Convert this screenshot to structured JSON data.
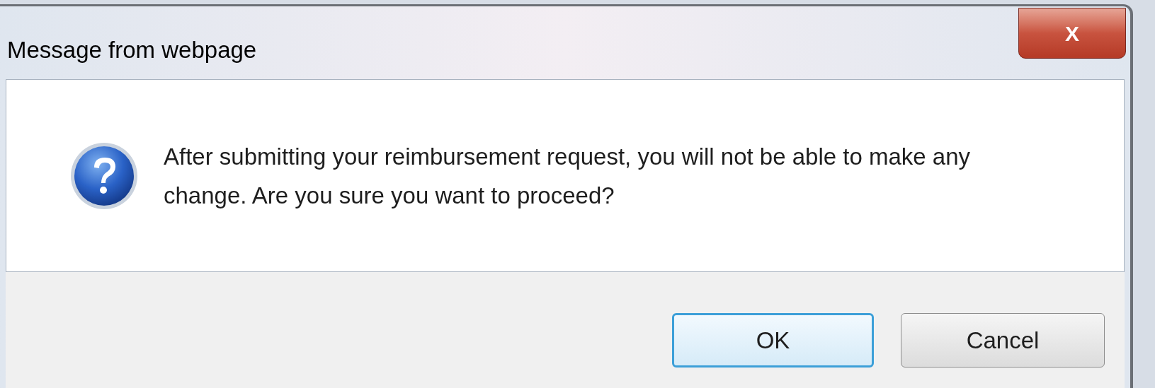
{
  "window": {
    "title": "Message from webpage",
    "close_label": "X"
  },
  "message": "After submitting your reimbursement request, you will not be able to make any change. Are you sure you want to proceed?",
  "buttons": [
    {
      "label": "OK",
      "focused": true
    },
    {
      "label": "Cancel",
      "focused": false
    }
  ]
}
